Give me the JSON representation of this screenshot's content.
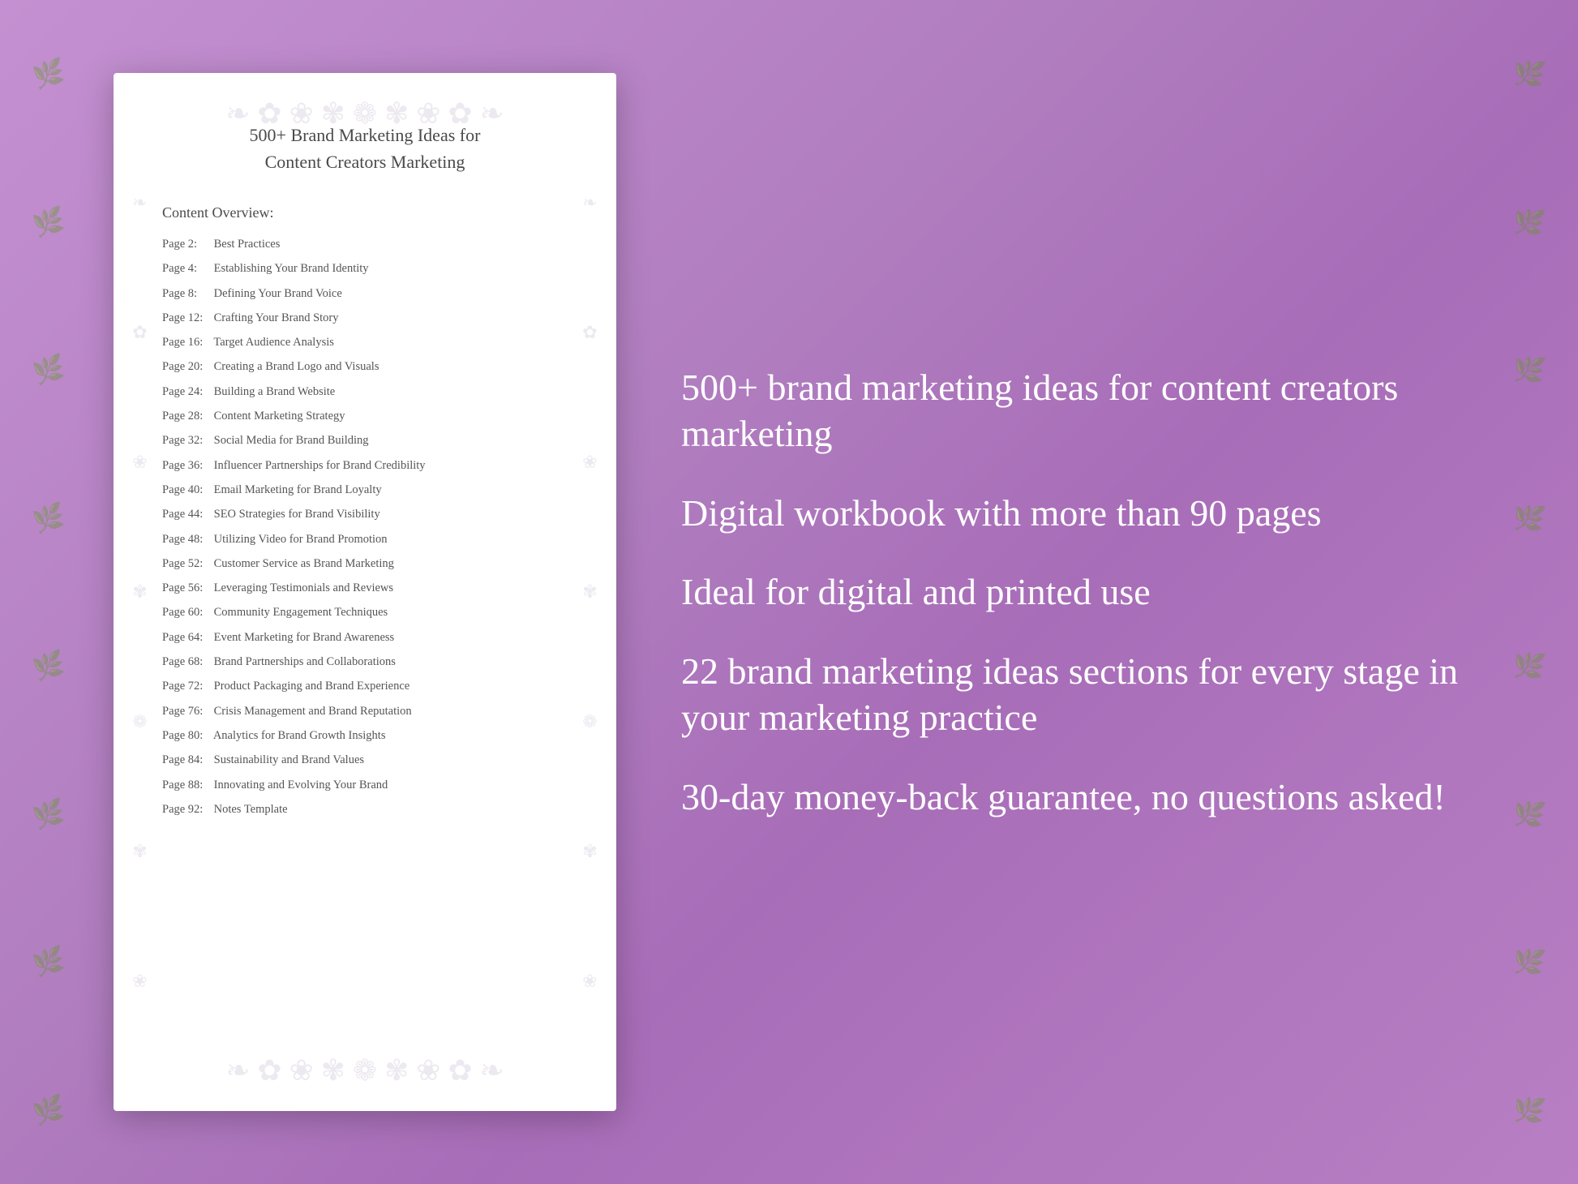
{
  "background": {
    "color": "#b87fc4"
  },
  "document": {
    "title_line1": "500+ Brand Marketing Ideas for",
    "title_line2": "Content Creators Marketing",
    "section_label": "Content Overview:",
    "toc": [
      {
        "page": "Page  2:",
        "title": "Best Practices"
      },
      {
        "page": "Page  4:",
        "title": "Establishing Your Brand Identity"
      },
      {
        "page": "Page  8:",
        "title": "Defining Your Brand Voice"
      },
      {
        "page": "Page 12:",
        "title": "Crafting Your Brand Story"
      },
      {
        "page": "Page 16:",
        "title": "Target Audience Analysis"
      },
      {
        "page": "Page 20:",
        "title": "Creating a Brand Logo and Visuals"
      },
      {
        "page": "Page 24:",
        "title": "Building a Brand Website"
      },
      {
        "page": "Page 28:",
        "title": "Content Marketing Strategy"
      },
      {
        "page": "Page 32:",
        "title": "Social Media for Brand Building"
      },
      {
        "page": "Page 36:",
        "title": "Influencer Partnerships for Brand Credibility"
      },
      {
        "page": "Page 40:",
        "title": "Email Marketing for Brand Loyalty"
      },
      {
        "page": "Page 44:",
        "title": "SEO Strategies for Brand Visibility"
      },
      {
        "page": "Page 48:",
        "title": "Utilizing Video for Brand Promotion"
      },
      {
        "page": "Page 52:",
        "title": "Customer Service as Brand Marketing"
      },
      {
        "page": "Page 56:",
        "title": "Leveraging Testimonials and Reviews"
      },
      {
        "page": "Page 60:",
        "title": "Community Engagement Techniques"
      },
      {
        "page": "Page 64:",
        "title": "Event Marketing for Brand Awareness"
      },
      {
        "page": "Page 68:",
        "title": "Brand Partnerships and Collaborations"
      },
      {
        "page": "Page 72:",
        "title": "Product Packaging and Brand Experience"
      },
      {
        "page": "Page 76:",
        "title": "Crisis Management and Brand Reputation"
      },
      {
        "page": "Page 80:",
        "title": "Analytics for Brand Growth Insights"
      },
      {
        "page": "Page 84:",
        "title": "Sustainability and Brand Values"
      },
      {
        "page": "Page 88:",
        "title": "Innovating and Evolving Your Brand"
      },
      {
        "page": "Page 92:",
        "title": "Notes Template"
      }
    ]
  },
  "features": [
    {
      "id": "feature1",
      "text": "500+ brand marketing ideas for content creators marketing"
    },
    {
      "id": "feature2",
      "text": "Digital workbook with more than 90 pages"
    },
    {
      "id": "feature3",
      "text": "Ideal for digital and printed use"
    },
    {
      "id": "feature4",
      "text": "22 brand marketing ideas sections for every stage in your marketing practice"
    },
    {
      "id": "feature5",
      "text": "30-day money-back guarantee, no questions asked!"
    }
  ],
  "floral_glyphs": [
    "❧",
    "✿",
    "❀",
    "✾",
    "❁",
    "✽",
    "❃",
    "✻",
    "✺"
  ],
  "doc_floral": "❧ ✿ ❀ ✾ ❁"
}
